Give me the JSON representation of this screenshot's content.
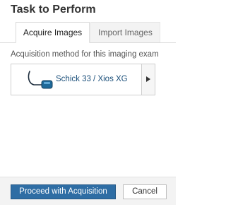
{
  "title": "Task to Perform",
  "tabs": [
    {
      "label": "Acquire Images",
      "active": true
    },
    {
      "label": "Import Images",
      "active": false
    }
  ],
  "instruction": "Acquisition method for this imaging exam",
  "device": {
    "label": "Schick 33 / Xios XG",
    "icon": "sensor-cable-icon"
  },
  "actions": {
    "proceed_label": "Proceed with Acquisition",
    "cancel_label": "Cancel"
  },
  "colors": {
    "primary": "#2e6da4",
    "device_text": "#1b4f7a"
  }
}
